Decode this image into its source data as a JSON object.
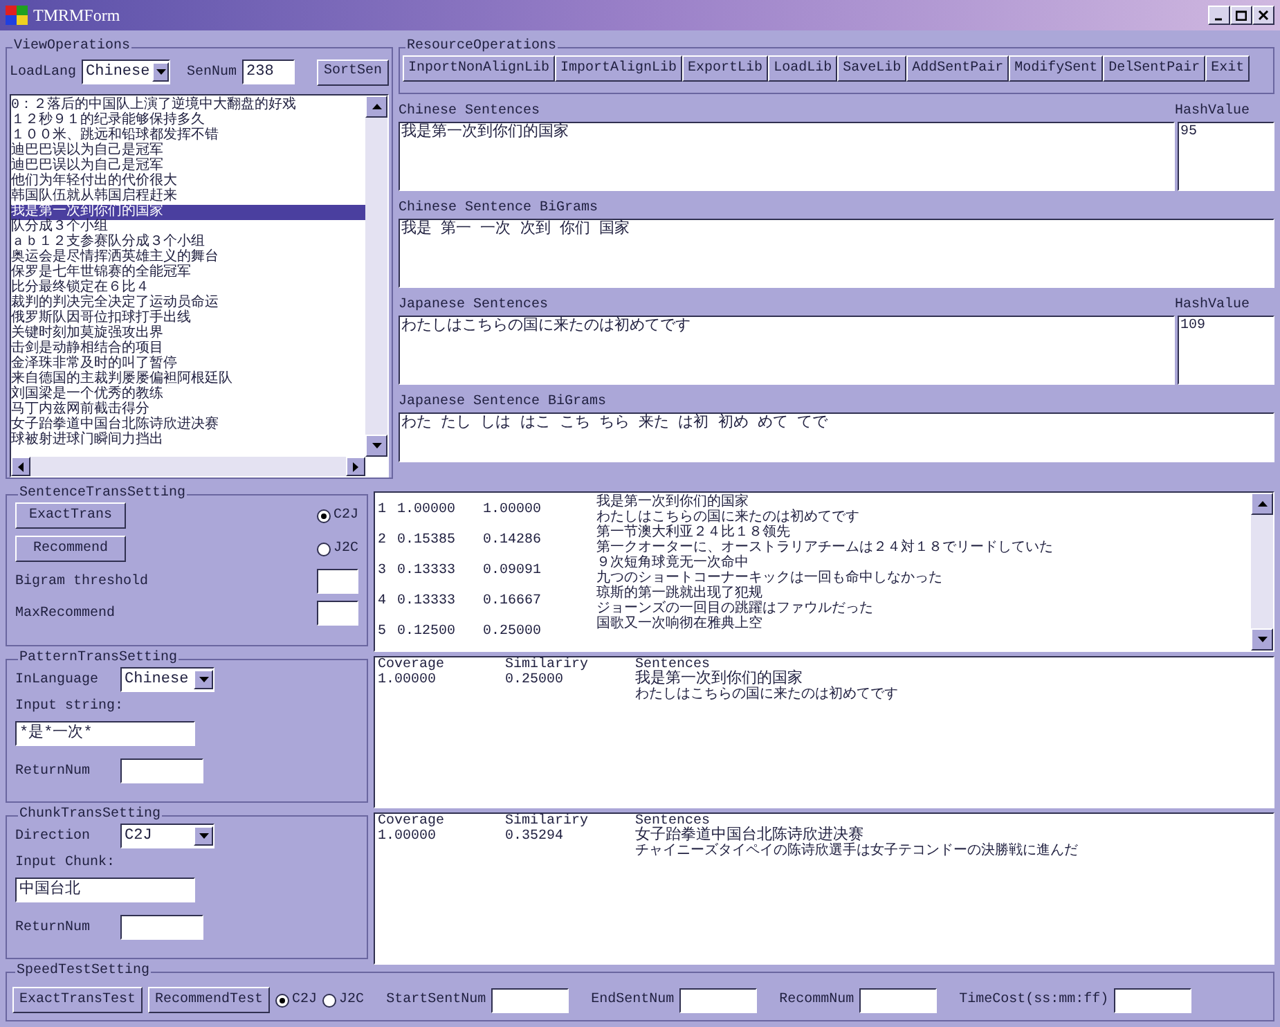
{
  "window": {
    "title": "TMRMForm"
  },
  "view_operations": {
    "title": "ViewOperations",
    "load_lang_label": "LoadLang",
    "load_lang_value": "Chinese",
    "sen_num_label": "SenNum",
    "sen_num_value": "238",
    "sort_button": "SortSen",
    "sentences": [
      {
        "text": "0：２落后的中国队上演了逆境中大翻盘的好戏",
        "selected": false
      },
      {
        "text": "１２秒９１的纪录能够保持多久",
        "selected": false
      },
      {
        "text": "１００米、跳远和铅球都发挥不错",
        "selected": false
      },
      {
        "text": "迪巴巴误以为自己是冠军",
        "selected": false
      },
      {
        "text": "迪巴巴误以为自己是冠军",
        "selected": false
      },
      {
        "text": "他们为年轻付出的代价很大",
        "selected": false
      },
      {
        "text": "韩国队伍就从韩国启程赶来",
        "selected": false
      },
      {
        "text": "我是第一次到你们的国家",
        "selected": true
      },
      {
        "text": "队分成３个小组",
        "selected": false
      },
      {
        "text": "ａｂ１２支参赛队分成３个小组",
        "selected": false
      },
      {
        "text": "奥运会是尽情挥洒英雄主义的舞台",
        "selected": false
      },
      {
        "text": "保罗是七年世锦赛的全能冠军",
        "selected": false
      },
      {
        "text": "比分最终锁定在６比４",
        "selected": false
      },
      {
        "text": "裁判的判决完全决定了运动员命运",
        "selected": false
      },
      {
        "text": "俄罗斯队因哥位扣球打手出线",
        "selected": false
      },
      {
        "text": "关键时刻加莫旋强攻出界",
        "selected": false
      },
      {
        "text": "击剑是动静相结合的项目",
        "selected": false
      },
      {
        "text": "金泽珠非常及时的叫了暂停",
        "selected": false
      },
      {
        "text": "来自德国的主裁判屡屡偏袒阿根廷队",
        "selected": false
      },
      {
        "text": "刘国梁是一个优秀的教练",
        "selected": false
      },
      {
        "text": "马丁内兹网前截击得分",
        "selected": false
      },
      {
        "text": "女子跆拳道中国台北陈诗欣进决赛",
        "selected": false
      },
      {
        "text": "球被射进球门瞬间力挡出",
        "selected": false
      }
    ]
  },
  "resource_operations": {
    "title": "ResourceOperations",
    "buttons": [
      "InportNonAlignLib",
      "ImportAlignLib",
      "ExportLib",
      "LoadLib",
      "SaveLib",
      "AddSentPair",
      "ModifySent",
      "DelSentPair",
      "Exit"
    ]
  },
  "chinese": {
    "label": "Chinese Sentences",
    "value": "我是第一次到你们的国家",
    "hash_label": "HashValue",
    "hash_value": "95"
  },
  "chinese_bigrams": {
    "label": "Chinese Sentence BiGrams",
    "value": "我是 第一 一次 次到 你们 国家"
  },
  "japanese": {
    "label": "Japanese Sentences",
    "value": "わたしはこちらの国に来たのは初めてです",
    "hash_label": "HashValue",
    "hash_value": "109"
  },
  "japanese_bigrams": {
    "label": "Japanese Sentence BiGrams",
    "value": "わた たし しは はこ こち ちら 来た は初 初め めて てで"
  },
  "sentence_trans": {
    "title": "SentenceTransSetting",
    "exact_button": "ExactTrans",
    "recommend_button": "Recommend",
    "directions": [
      {
        "label": "C2J",
        "selected": true
      },
      {
        "label": "J2C",
        "selected": false
      }
    ],
    "bigram_label": "Bigram threshold",
    "max_label": "MaxRecommend",
    "results": [
      {
        "index": "1",
        "coverage": "1.00000",
        "similarity": "1.00000",
        "source": "我是第一次到你们的国家",
        "target": "わたしはこちらの国に来たのは初めてです"
      },
      {
        "index": "2",
        "coverage": "0.15385",
        "similarity": "0.14286",
        "source": "第一节澳大利亚２４比１８领先",
        "target": "第一クオーターに、オーストラリアチームは２４対１８でリードしていた"
      },
      {
        "index": "3",
        "coverage": "0.13333",
        "similarity": "0.09091",
        "source": "９次短角球竟无一次命中",
        "target": "九つのショートコーナーキックは一回も命中しなかった"
      },
      {
        "index": "4",
        "coverage": "0.13333",
        "similarity": "0.16667",
        "source": "琼斯的第一跳就出现了犯规",
        "target": "ジョーンズの一回目の跳躍はファウルだった"
      },
      {
        "index": "5",
        "coverage": "0.12500",
        "similarity": "0.25000",
        "source": "国歌又一次响彻在雅典上空"
      }
    ]
  },
  "pattern_trans": {
    "title": "PatternTransSetting",
    "language_label": "InLanguage",
    "language_value": "Chinese",
    "input_label": "Input string:",
    "input_value": "*是*一次*",
    "return_label": "ReturnNum",
    "headers": [
      "Coverage",
      "Similariry",
      "Sentences"
    ],
    "rows": [
      {
        "coverage": "1.00000",
        "similarity": "0.25000",
        "source": "我是第一次到你们的国家",
        "target": "わたしはこちらの国に来たのは初めてです"
      }
    ]
  },
  "chunk_trans": {
    "title": "ChunkTransSetting",
    "direction_label": "Direction",
    "direction_value": "C2J",
    "input_label": "Input Chunk:",
    "input_value": "中国台北",
    "return_label": "ReturnNum",
    "headers": [
      "Coverage",
      "Similariry",
      "Sentences"
    ],
    "rows": [
      {
        "coverage": "1.00000",
        "similarity": "0.35294",
        "source": "女子跆拳道中国台北陈诗欣进决赛",
        "target": "チャイニーズタイペイの陈诗欣選手は女子テコンドーの決勝戦に進んだ"
      }
    ]
  },
  "speed_test": {
    "title": "SpeedTestSetting",
    "buttons": [
      "ExactTransTest",
      "RecommendTest"
    ],
    "directions": [
      {
        "label": "C2J",
        "selected": true
      },
      {
        "label": "J2C",
        "selected": false
      }
    ],
    "fields": [
      "StartSentNum",
      "EndSentNum",
      "RecommNum",
      "TimeCost(ss:mm:ff)"
    ]
  }
}
